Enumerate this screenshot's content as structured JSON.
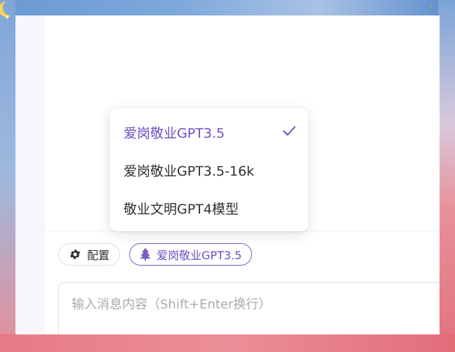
{
  "composer": {
    "config_button": {
      "label": "配置",
      "icon": "gear-icon"
    },
    "model_button": {
      "label": "爱岗敬业GPT3.5",
      "icon": "tree-icon"
    },
    "input_placeholder": "输入消息内容（Shift+Enter换行）"
  },
  "model_menu": {
    "items": [
      {
        "label": "爱岗敬业GPT3.5",
        "selected": true
      },
      {
        "label": "爱岗敬业GPT3.5-16k",
        "selected": false
      },
      {
        "label": "敬业文明GPT4模型",
        "selected": false
      }
    ]
  },
  "colors": {
    "accent": "#6d4fbf",
    "text": "#303133",
    "placeholder": "#a8abb2",
    "border": "#dcdfe6"
  }
}
